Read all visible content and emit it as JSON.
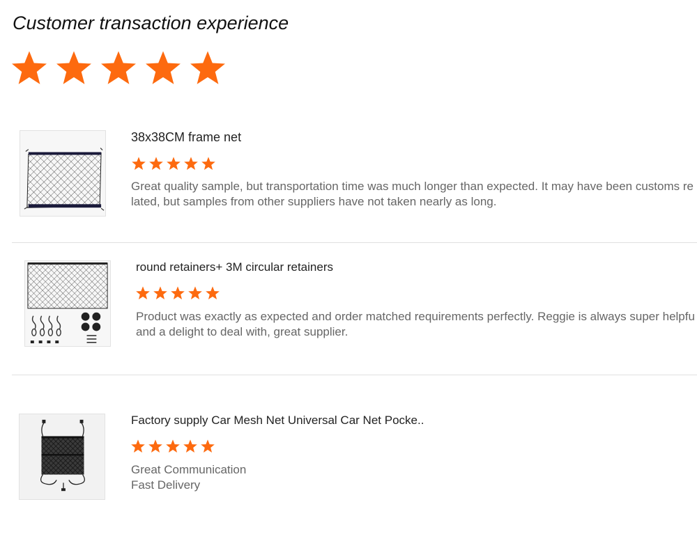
{
  "page": {
    "title": "Customer transaction experience",
    "overall_rating": 5,
    "star_color": "#fd6a0f"
  },
  "reviews": [
    {
      "product_name": "38x38CM frame net",
      "rating": 5,
      "thumbnail_icon": "frame-net-icon",
      "comment_lines": [
        "Great quality sample, but transportation time was much longer than expected. It may have been customs re",
        "lated, but samples from other suppliers have not taken nearly as long."
      ]
    },
    {
      "product_name": "round retainers+ 3M circular retainers",
      "rating": 5,
      "thumbnail_icon": "cargo-net-with-retainers-icon",
      "comment_lines": [
        "Product was exactly as expected and order matched requirements perfectly. Reggie is always super helpfu",
        "and a delight to deal with, great supplier."
      ]
    },
    {
      "product_name": "Factory supply Car Mesh Net Universal Car Net Pocke..",
      "rating": 5,
      "thumbnail_icon": "car-mesh-pocket-icon",
      "comment_lines": [
        "Great Communication",
        "Fast Delivery"
      ]
    }
  ]
}
